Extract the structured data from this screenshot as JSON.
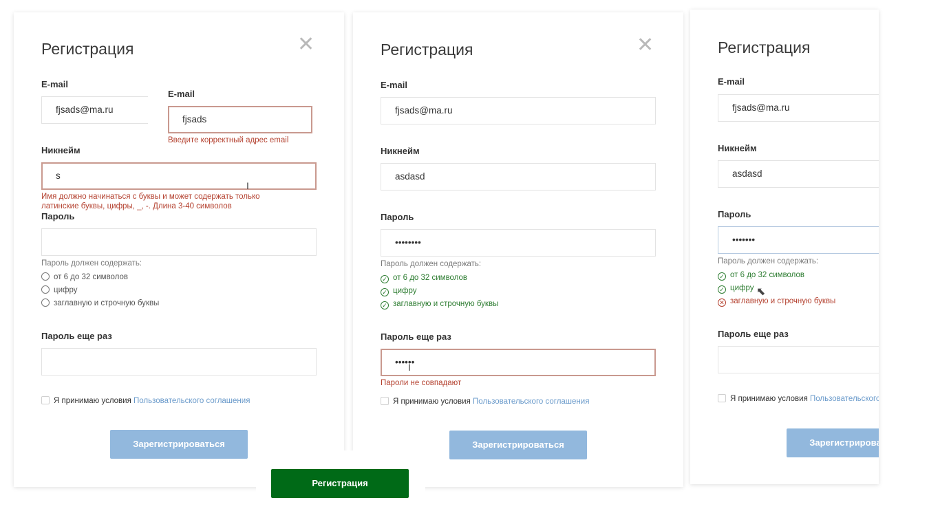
{
  "panel1": {
    "title": "Регистрация",
    "email_label": "E-mail",
    "email_value": "fjsads@ma.ru",
    "email_overlay_label": "E-mail",
    "email_overlay_value": "fjsads",
    "email_error": "Введите корректный адрес email",
    "nick_label": "Никнейм",
    "nick_value": "s",
    "nick_error_1": "Имя должно начинаться с буквы и может содержать только",
    "nick_error_2": "латинские буквы, цифры, _, -. Длина 3-40 символов",
    "pass_label": "Пароль",
    "pass_hint": "Пароль должен содержать:",
    "req1": "от 6 до 32 символов",
    "req2": "цифру",
    "req3": "заглавную и строчную буквы",
    "pass2_label": "Пароль еще раз",
    "agree_text": "Я принимаю условия ",
    "agree_link": "Пользовательского соглашения",
    "submit": "Зарегистрироваться"
  },
  "panel2": {
    "title": "Регистрация",
    "email_label": "E-mail",
    "email_value": "fjsads@ma.ru",
    "nick_label": "Никнейм",
    "nick_value": "asdasd",
    "pass_label": "Пароль",
    "pass_value": "••••••••",
    "pass_hint": "Пароль должен содержать:",
    "req1": "от 6 до 32 символов",
    "req2": "цифру",
    "req3": "заглавную и строчную буквы",
    "pass2_label": "Пароль еще раз",
    "pass2_value": "••••••",
    "pass2_error": "Пароли не совпадают",
    "agree_text": "Я принимаю условия ",
    "agree_link": "Пользовательского соглашения",
    "submit": "Зарегистрироваться"
  },
  "panel3": {
    "title": "Регистрация",
    "email_label": "E-mail",
    "email_value": "fjsads@ma.ru",
    "nick_label": "Никнейм",
    "nick_value": "asdasd",
    "pass_label": "Пароль",
    "pass_value": "•••••••",
    "pass_hint": "Пароль должен содержать:",
    "req1": "от 6 до 32 символов",
    "req2": "цифру",
    "req3": "заглавную и строчную буквы",
    "pass2_label": "Пароль еще раз",
    "agree_text": "Я принимаю условия ",
    "agree_link": "Пользовательского соглашения",
    "submit": "Зарегистрироваться"
  },
  "green_button": "Регистрация",
  "icons": {
    "close": "close-icon",
    "valid": "check-circle-icon",
    "invalid": "x-circle-icon",
    "empty": "empty-circle-icon"
  },
  "colors": {
    "error": "#b4412f",
    "valid": "#2e7d32",
    "button": "#92b8dd",
    "green_button": "#006a17",
    "link": "#6b9bcb"
  }
}
